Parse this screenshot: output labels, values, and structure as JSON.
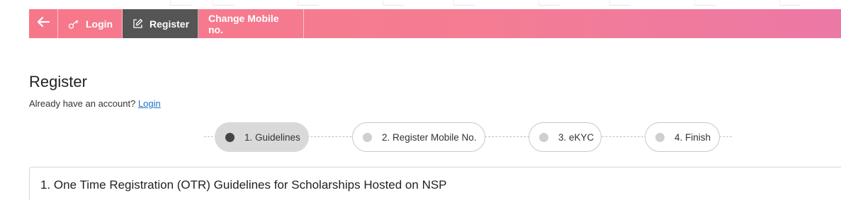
{
  "nav": {
    "back_icon": "arrow-left-icon",
    "items": [
      {
        "label": "Login",
        "icon": "key-icon"
      },
      {
        "label": "Register",
        "icon": "edit-icon"
      },
      {
        "label": "Change Mobile no.",
        "icon": ""
      }
    ],
    "active_item": "Register",
    "colors": {
      "bar_start": "#f7778a",
      "bar_end": "#ec78a6",
      "active_bg": "#555555"
    }
  },
  "main": {
    "title": "Register",
    "account_prompt": "Already have an account?",
    "login_link": "Login"
  },
  "stepper": {
    "steps": [
      {
        "label": "1. Guidelines",
        "active": true
      },
      {
        "label": "2. Register Mobile No.",
        "active": false
      },
      {
        "label": "3. eKYC",
        "active": false
      },
      {
        "label": "4. Finish",
        "active": false
      }
    ]
  },
  "panel": {
    "title": "1. One Time Registration (OTR) Guidelines for Scholarships Hosted on NSP"
  }
}
